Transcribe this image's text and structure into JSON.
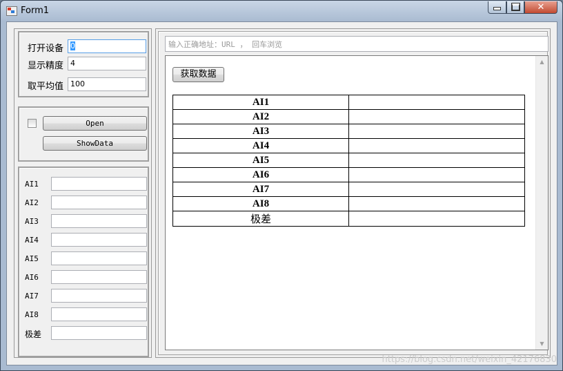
{
  "window": {
    "title": "Form1"
  },
  "controls": {
    "minimize": "",
    "maximize": "",
    "close": "✕"
  },
  "settings": {
    "rows": [
      {
        "label": "打开设备",
        "value": "0",
        "selected": true
      },
      {
        "label": "显示精度",
        "value": "4"
      },
      {
        "label": "取平均值",
        "value": "100"
      }
    ]
  },
  "actions": {
    "open_label": "Open",
    "showdata_label": "ShowData"
  },
  "ai_fields": {
    "labels": [
      "AI1",
      "AI2",
      "AI3",
      "AI4",
      "AI5",
      "AI6",
      "AI7",
      "AI8",
      "极差"
    ],
    "values": [
      "",
      "",
      "",
      "",
      "",
      "",
      "",
      "",
      ""
    ]
  },
  "browser": {
    "url_placeholder": "输入正确地址：URL ， 回车浏览",
    "fetch_button": "获取数据",
    "table": {
      "rows": [
        {
          "key": "AI1",
          "value": ""
        },
        {
          "key": "AI2",
          "value": ""
        },
        {
          "key": "AI3",
          "value": ""
        },
        {
          "key": "AI4",
          "value": ""
        },
        {
          "key": "AI5",
          "value": ""
        },
        {
          "key": "AI6",
          "value": ""
        },
        {
          "key": "AI7",
          "value": ""
        },
        {
          "key": "AI8",
          "value": ""
        },
        {
          "key": "极差",
          "value": ""
        }
      ]
    }
  },
  "watermark": "https://blog.csdn.net/weixin_42176830"
}
